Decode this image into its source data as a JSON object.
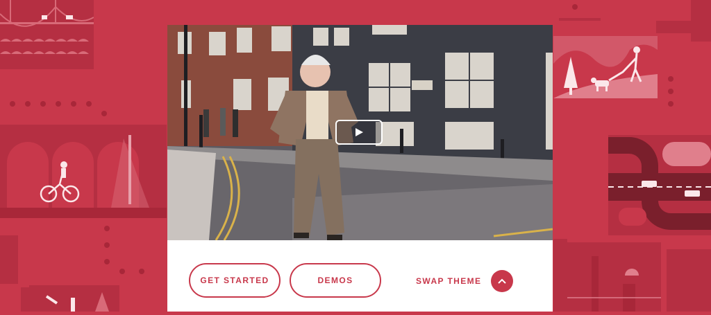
{
  "video": {
    "play_icon": "play-icon",
    "scene": "street-photo"
  },
  "actions": {
    "get_started_label": "GET STARTED",
    "demos_label": "DEMOS",
    "swap_theme_label": "SWAP THEME",
    "swap_theme_icon": "chevron-up-icon"
  },
  "colors": {
    "background": "#c8384b",
    "panel": "#b52f42",
    "accent": "#c8384b",
    "card": "#ffffff"
  }
}
